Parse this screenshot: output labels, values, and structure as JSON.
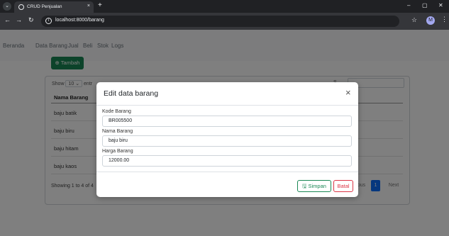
{
  "browser": {
    "tab_title": "CRUD Penjualan",
    "tab_close": "×",
    "new_tab": "+",
    "url": "localhost:8000/barang",
    "profile_initial": "M",
    "window_controls": {
      "minimize": "–",
      "maximize": "▢",
      "close": "✕"
    }
  },
  "navbar": {
    "items": [
      {
        "label": "Beranda"
      },
      {
        "label": "Data Barang"
      },
      {
        "label": "Jual"
      },
      {
        "label": "Beli"
      },
      {
        "label": "Stok"
      },
      {
        "label": "Logs"
      }
    ]
  },
  "page": {
    "add_button": "Tambah",
    "add_icon": "⊕",
    "show_label": "Show",
    "show_value": "10",
    "entries_partial": "entr",
    "search_partial": "S",
    "table": {
      "header": "Nama Barang",
      "rows": [
        "baju batik",
        "baju biru",
        "baju hitam",
        "baju kaos"
      ]
    },
    "info": "Showing 1 to 4 of 4",
    "pagination": {
      "previous_partial": "vious",
      "current": "1",
      "next": "Next"
    }
  },
  "modal": {
    "title": "Edit data barang",
    "close_icon": "×",
    "fields": [
      {
        "label": "Kode Barang",
        "value": "BR005500"
      },
      {
        "label": "Nama Barang",
        "value": "baju biru"
      },
      {
        "label": "Harga Barang",
        "value": "12000.00"
      }
    ],
    "save_label": "Simpan",
    "save_icon": "🖫",
    "cancel_label": "Batal"
  },
  "colors": {
    "accent_green": "#198754",
    "danger_red": "#dc3545",
    "primary_blue": "#0d6efd"
  }
}
